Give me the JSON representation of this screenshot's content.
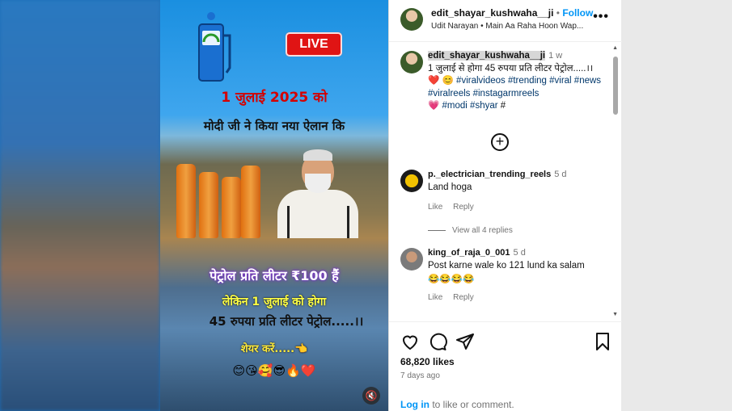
{
  "video": {
    "live_label": "LIVE",
    "line1": "1 जुलाई 2025 को",
    "line2": "मोदी जी ने किया नया ऐलान कि",
    "line3": "पेट्रोल प्रति लीटर ₹100 हैं",
    "line4": "लेकिन 1 जुलाई को होगा",
    "line5": "45 रुपया प्रति लीटर पेट्रोल.....।।",
    "line6": "शेयर करें.....👈",
    "line7": "😊😘🥰😎🔥❤️",
    "mute_icon": "🔇"
  },
  "header": {
    "username": "edit_shayar_kushwaha__ji",
    "separator": "•",
    "follow_label": "Follow",
    "audio": "Udit Narayan • Main Aa Raha Hoon Wap...",
    "more_label": "•••"
  },
  "caption": {
    "username": "edit_shayar_kushwaha__ji",
    "time": "1 w",
    "text": "1 जुलाई से होगा 45 रुपया प्रति लीटर पेट्रोल.....।।❤️ 😊",
    "tags1": "#viralvideos #trending",
    "tags2": "#viral #news #viralreels #instagarmreels",
    "tags3_prefix": "💗",
    "tags3": "#modi #shyar",
    "tags3_suffix": "#"
  },
  "load_more_icon": "+",
  "comments": [
    {
      "username": "p._electrician_trending_reels",
      "time": "5 d",
      "text": "Land hoga",
      "like_label": "Like",
      "reply_label": "Reply",
      "view_replies": "View all 4 replies"
    },
    {
      "username": "king_of_raja_0_001",
      "time": "5 d",
      "text": "Post karne wale ko 121 lund ka salam",
      "emoji": "😂😂😂😂",
      "like_label": "Like",
      "reply_label": "Reply"
    }
  ],
  "footer": {
    "likes": "68,820 likes",
    "ago": "7 days ago",
    "login_link": "Log in",
    "login_rest": " to like or comment."
  },
  "icons": {
    "like": "heart-icon",
    "comment": "comment-icon",
    "share": "share-icon",
    "save": "bookmark-icon"
  }
}
